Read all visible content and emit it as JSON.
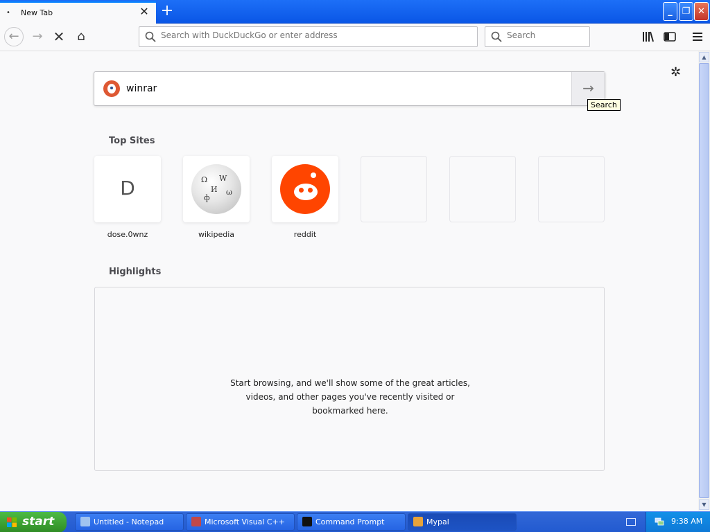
{
  "browser": {
    "tab": {
      "title": "New Tab",
      "dot": "•",
      "close": "✕"
    },
    "new_tab": "+",
    "window_buttons": {
      "minimize": "_",
      "maximize": "❐",
      "close": "✕"
    },
    "nav": {
      "back": "←",
      "forward": "→",
      "stop": "✕",
      "home": "⌂"
    },
    "urlbar": {
      "placeholder": "Search with DuckDuckGo or enter address"
    },
    "searchbar": {
      "placeholder": "Search"
    },
    "toolbar_icons": [
      "library-icon",
      "sidebar-icon",
      "menu-icon"
    ]
  },
  "newtab": {
    "search": {
      "query": "winrar",
      "go_arrow": "→",
      "tooltip": "Search"
    },
    "settings_glyph": "✲",
    "top_sites_title": "Top Sites",
    "top_sites": [
      {
        "label": "dose.0wnz",
        "letter": "D"
      },
      {
        "label": "wikipedia",
        "icon": "wikipedia-globe-icon"
      },
      {
        "label": "reddit",
        "icon": "reddit-alien-icon"
      }
    ],
    "highlights_title": "Highlights",
    "highlights_message": "Start browsing, and we'll show some of the great articles, videos, and other pages you've recently visited or bookmarked here."
  },
  "taskbar": {
    "start_label": "start",
    "tasks": [
      {
        "label": "Untitled - Notepad",
        "icon": "notepad-icon"
      },
      {
        "label": "Microsoft Visual C++",
        "icon": "visual-cpp-icon"
      },
      {
        "label": "Command Prompt",
        "icon": "command-prompt-icon"
      },
      {
        "label": "Mypal",
        "icon": "mypal-icon"
      }
    ],
    "clock": "9:38 AM"
  },
  "colors": {
    "accent": "#0a84ff",
    "reddit": "#ff4500",
    "ddg": "#de5833",
    "xp_taskbar": "#245edb",
    "xp_start": "#3c9b2d"
  }
}
